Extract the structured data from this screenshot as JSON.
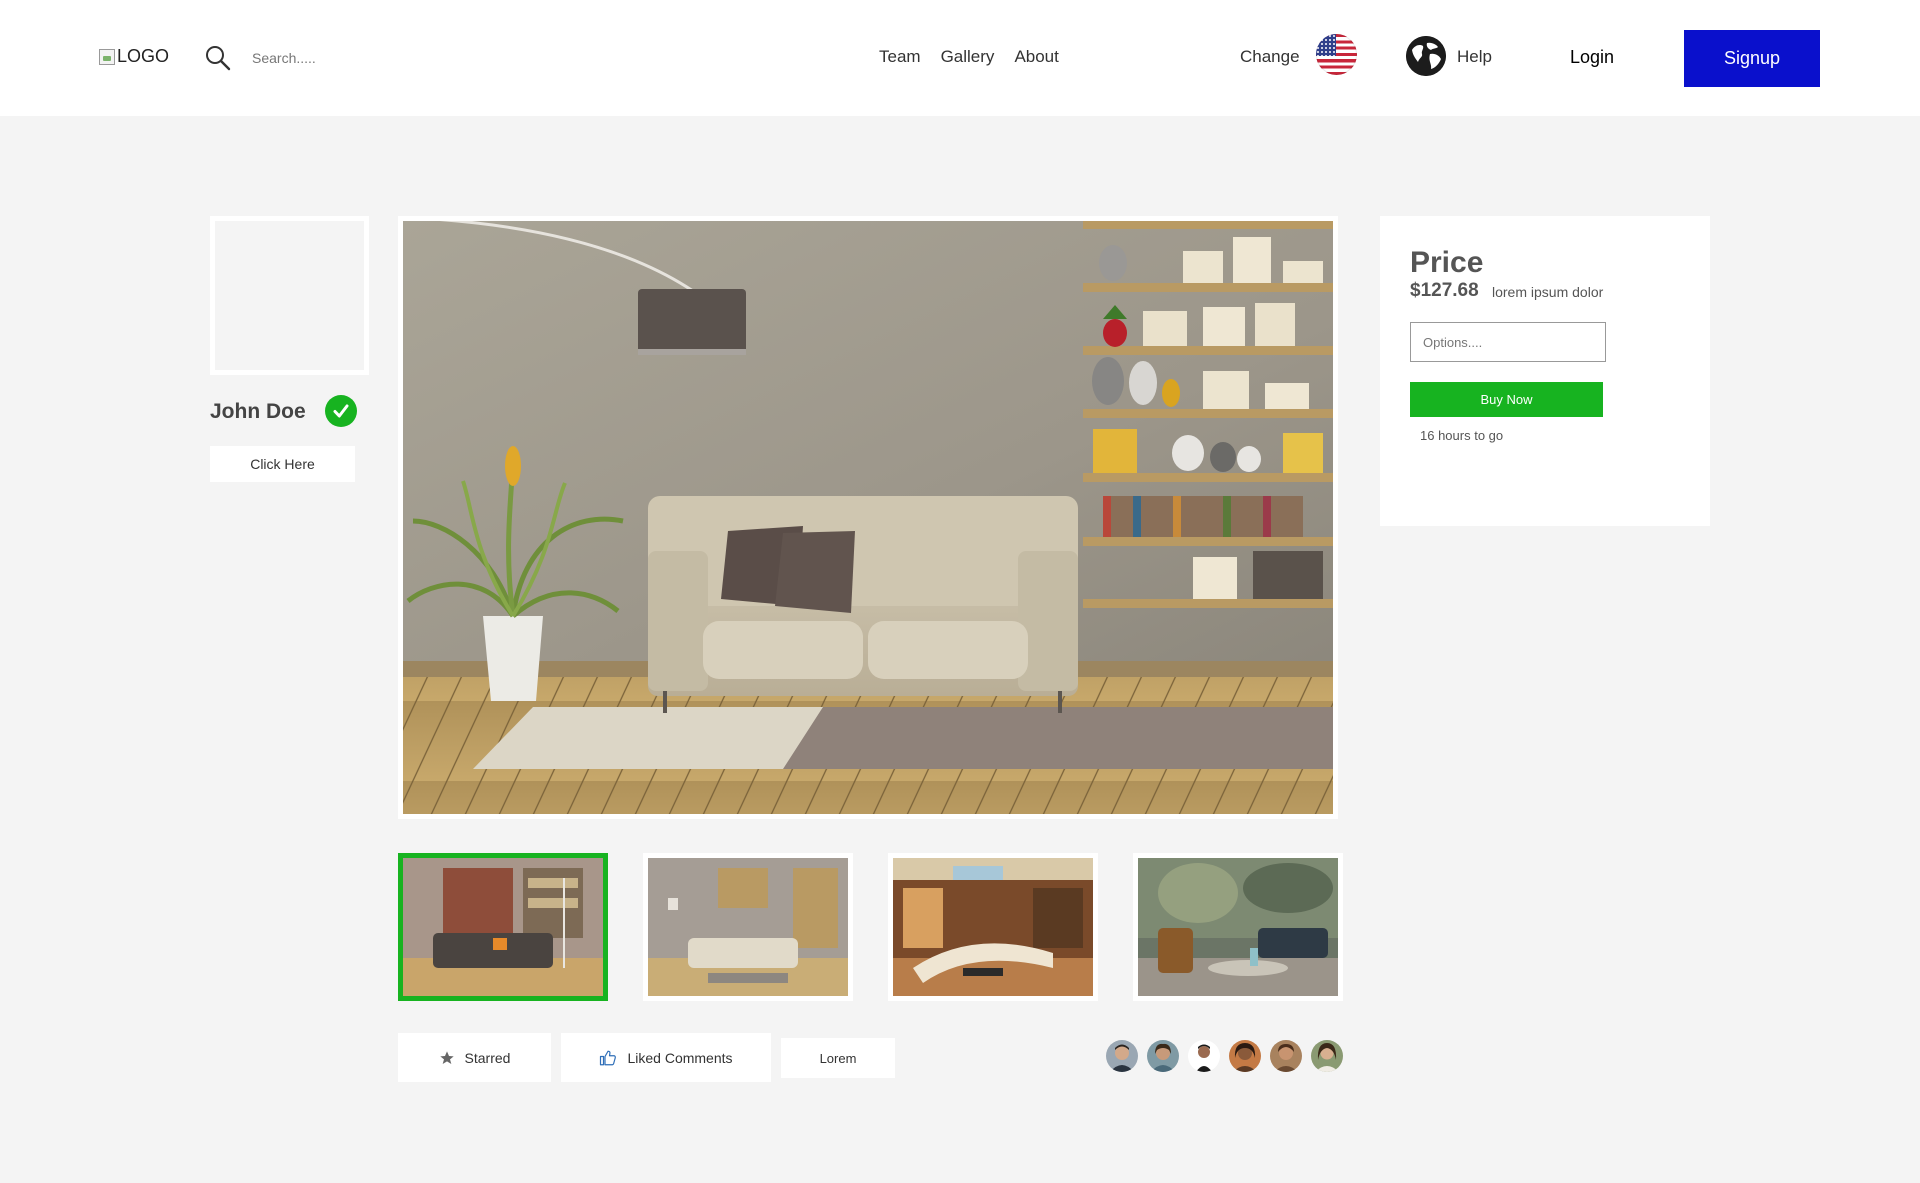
{
  "header": {
    "logo_alt": "LOGO",
    "search_placeholder": "Search.....",
    "nav": [
      "Team",
      "Gallery",
      "About"
    ],
    "change_label": "Change",
    "help_label": "Help",
    "login_label": "Login",
    "signup_label": "Signup"
  },
  "profile": {
    "name": "John Doe",
    "verified": true,
    "button_label": "Click Here"
  },
  "gallery": {
    "selected_index": 0,
    "thumbnail_count": 4
  },
  "actions": {
    "starred_label": "Starred",
    "liked_label": "Liked Comments",
    "lorem_label": "Lorem"
  },
  "people_count": 6,
  "price_card": {
    "title": "Price",
    "value": "$127.68",
    "description": "lorem ipsum dolor",
    "options_placeholder": "Options....",
    "buy_label": "Buy Now",
    "time_left": "16 hours to go"
  },
  "colors": {
    "accent_green": "#17b320",
    "signup_blue": "#0a10cc",
    "page_bg": "#f4f4f4"
  }
}
